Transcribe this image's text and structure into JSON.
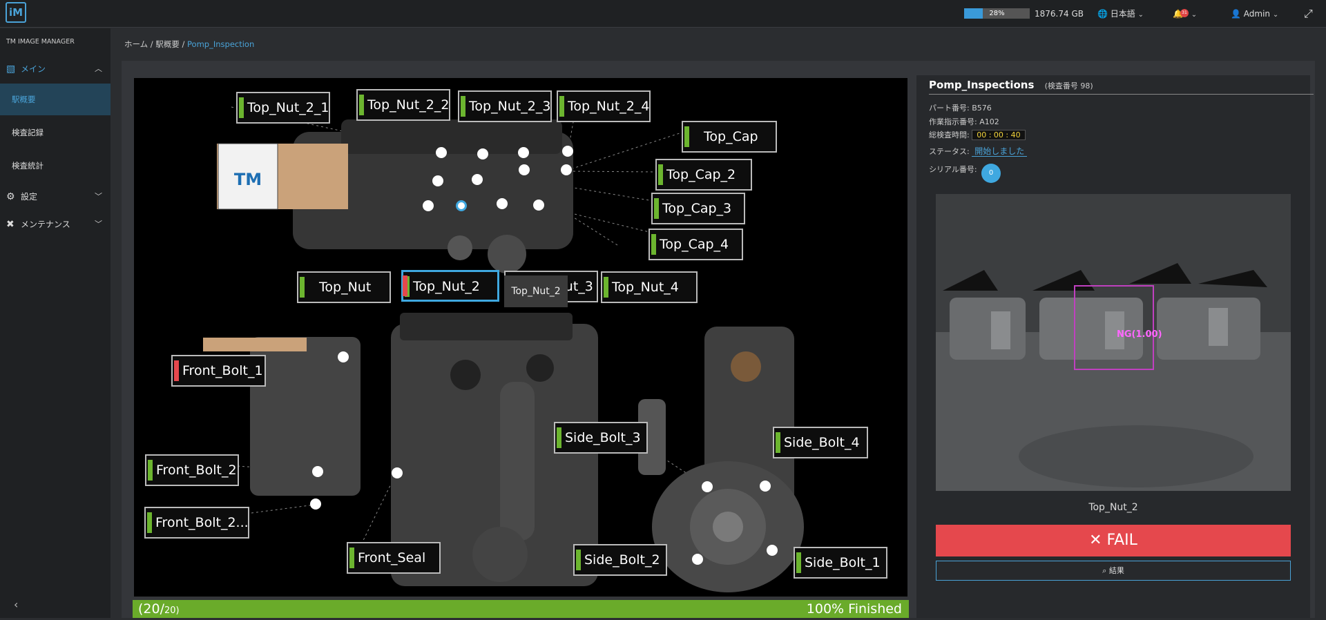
{
  "topbar": {
    "logo_text": "iM",
    "storage_percent": 28,
    "storage_percent_label": "28%",
    "storage_size": "1876.74 GB",
    "language": "日本語",
    "notification_count": "31",
    "user": "Admin"
  },
  "sidebar": {
    "app_name": "TM IMAGE MANAGER",
    "main_group": "メイン",
    "items": [
      "駅概要",
      "検査記録",
      "検査統計"
    ],
    "settings": "設定",
    "maintenance": "メンテナンス"
  },
  "breadcrumb": {
    "home": "ホーム",
    "overview": "駅概要",
    "current": "Pomp_Inspection"
  },
  "canvas": {
    "labels": {
      "top_nut_2_1": "Top_Nut_2_1",
      "top_nut_2_2": "Top_Nut_2_2",
      "top_nut_2_3": "Top_Nut_2_3",
      "top_nut_2_4": "Top_Nut_2_4",
      "top_cap": "Top_Cap",
      "top_cap_2": "Top_Cap_2",
      "top_cap_3": "Top_Cap_3",
      "top_cap_4": "Top_Cap_4",
      "top_nut": "Top_Nut",
      "top_nut_2": "Top_Nut_2",
      "top_nut_3": "Top_Nut_3",
      "top_nut_4": "Top_Nut_4",
      "front_bolt_1": "Front_Bolt_1",
      "front_bolt_2": "Front_Bolt_2",
      "front_bolt_2_more": "Front_Bolt_2...",
      "front_seal": "Front_Seal",
      "side_bolt_1": "Side_Bolt_1",
      "side_bolt_2": "Side_Bolt_2",
      "side_bolt_3": "Side_Bolt_3",
      "side_bolt_4": "Side_Bolt_4"
    },
    "tooltip": "Top_Nut_2"
  },
  "progress": {
    "current": "(20/",
    "total": "20)",
    "status": "100% Finished",
    "fraction": 1.0
  },
  "panel": {
    "title": "Pomp_Inspections",
    "inspection_no": "(検査番号 98)",
    "part_no": "パート番号: B576",
    "work_order": "作業指示番号: A102",
    "total_time_label": "総検査時間:",
    "total_time": "00 : 00 : 40",
    "status_label": "ステータス:",
    "status": "開始しました",
    "serial_label": "シリアル番号:",
    "serial": "0",
    "detection_label": "NG(1.00)",
    "image_name": "Top_Nut_2",
    "result": "✕ FAIL",
    "result_button": "結果"
  },
  "colors": {
    "accent": "#3fa8e0",
    "ok": "#6cb52f",
    "ng": "#e5484d",
    "progress": "#6aab2a"
  }
}
